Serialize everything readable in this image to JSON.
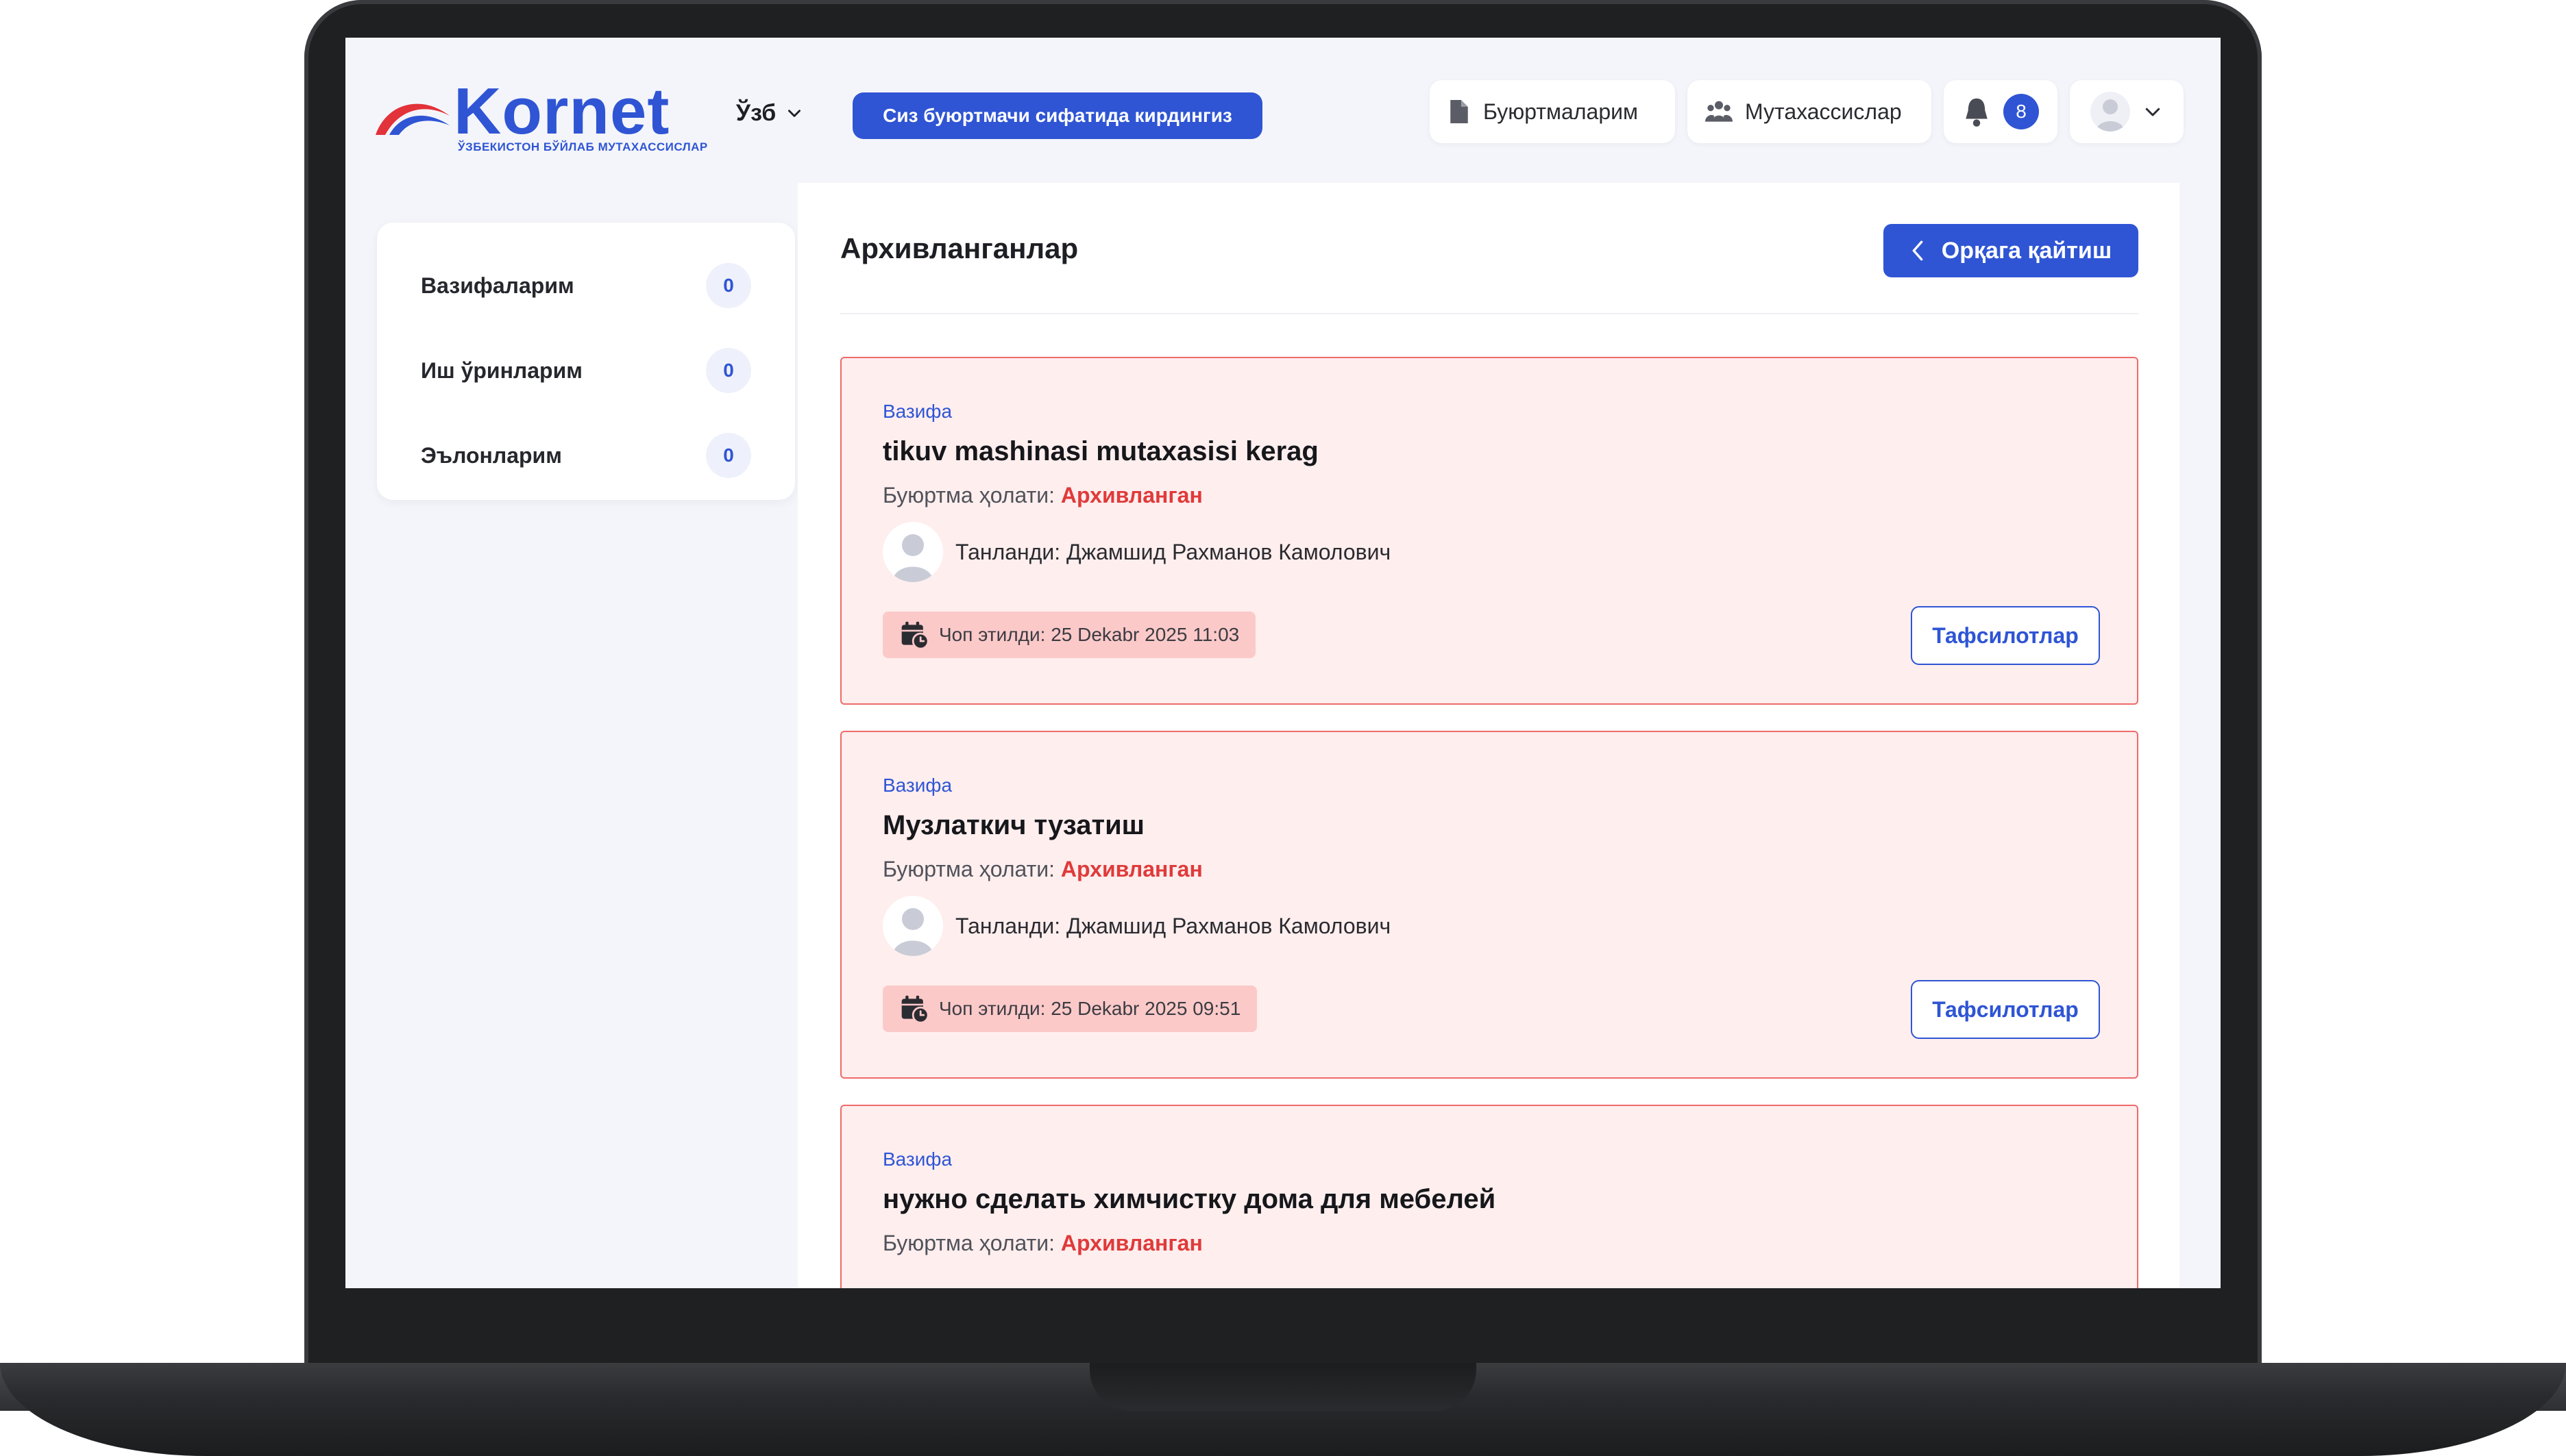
{
  "brand": {
    "name": "Kornet",
    "tagline": "ЎЗБЕКИСТОН БЎЙЛАБ МУТАХАССИСЛАР",
    "colors": {
      "primary": "#2f55d4",
      "logo_red": "#e2323a",
      "archived": "#e03a3a"
    }
  },
  "header": {
    "language": "Ўзб",
    "role_notice": "Сиз буюртмачи сифатида кирдингиз",
    "orders_label": "Буюртмаларим",
    "specialists_label": "Мутахассислар",
    "notifications_count": "8"
  },
  "sidebar": {
    "items": [
      {
        "label": "Вазифаларим",
        "count": "0"
      },
      {
        "label": "Иш ўринларим",
        "count": "0"
      },
      {
        "label": "Эълонларим",
        "count": "0"
      }
    ]
  },
  "main": {
    "title": "Архивланганлар",
    "back_label": "Орқага қайтиш",
    "cards": [
      {
        "type": "Вазифа",
        "title": "tikuv mashinasi mutaxasisi kerag",
        "status_label": "Буюртма ҳолати:",
        "status": "Архивланган",
        "chosen": "Танланди: Джамшид Рахманов Камолович",
        "published": "Чоп этилди: 25 Dekabr 2025 11:03",
        "details_label": "Тафсилотлар"
      },
      {
        "type": "Вазифа",
        "title": "Музлаткич тузатиш",
        "status_label": "Буюртма ҳолати:",
        "status": "Архивланган",
        "chosen": "Танланди: Джамшид Рахманов Камолович",
        "published": "Чоп этилди: 25 Dekabr 2025 09:51",
        "details_label": "Тафсилотлар"
      },
      {
        "type": "Вазифа",
        "title": "нужно сделать химчистку дома для мебелей",
        "status_label": "Буюртма ҳолати:",
        "status": "Архивланган"
      }
    ]
  },
  "icons": [
    "document-icon",
    "people-icon",
    "bell-icon",
    "user-avatar-icon",
    "chevron-down-icon",
    "chevron-left-icon",
    "calendar-clock-icon"
  ]
}
